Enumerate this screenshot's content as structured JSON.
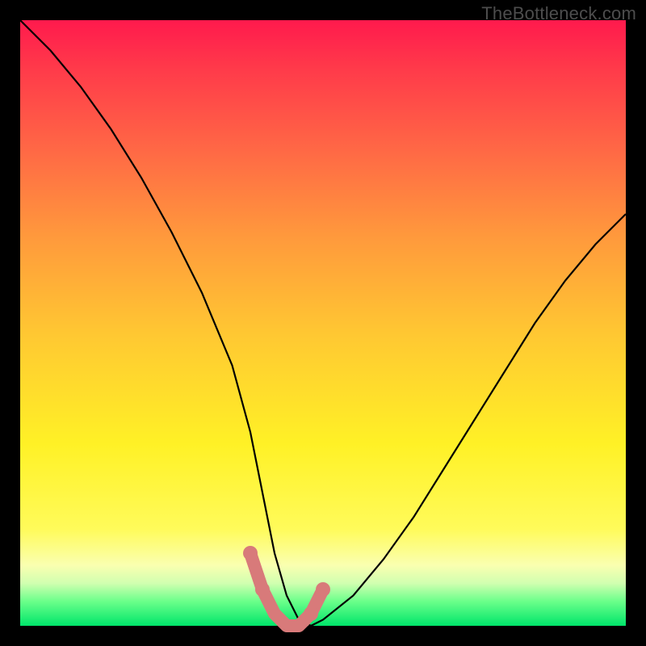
{
  "watermark": "TheBottleneck.com",
  "chart_data": {
    "type": "line",
    "title": "",
    "xlabel": "",
    "ylabel": "",
    "xlim": [
      0,
      100
    ],
    "ylim": [
      0,
      100
    ],
    "grid": false,
    "legend": false,
    "description": "Bottleneck curve: high values (red) fall sharply to a minimum (green) near the center-right, then rise again toward the right edge.",
    "series": [
      {
        "name": "bottleneck-curve",
        "x": [
          0,
          5,
          10,
          15,
          20,
          25,
          30,
          35,
          38,
          40,
          42,
          44,
          46,
          48,
          50,
          55,
          60,
          65,
          70,
          75,
          80,
          85,
          90,
          95,
          100
        ],
        "values": [
          100,
          95,
          89,
          82,
          74,
          65,
          55,
          43,
          32,
          22,
          12,
          5,
          1,
          0,
          1,
          5,
          11,
          18,
          26,
          34,
          42,
          50,
          57,
          63,
          68
        ]
      }
    ],
    "highlight": {
      "name": "optimal-zone-marker",
      "color": "#d87a7a",
      "x": [
        38,
        40,
        42,
        44,
        46,
        48,
        50
      ],
      "values": [
        12,
        6,
        2,
        0,
        0,
        2,
        6
      ]
    },
    "background_gradient": {
      "top_color": "#ff1a4d",
      "bottom_color": "#00e56a",
      "meaning": "red = high bottleneck, green = low bottleneck"
    }
  }
}
